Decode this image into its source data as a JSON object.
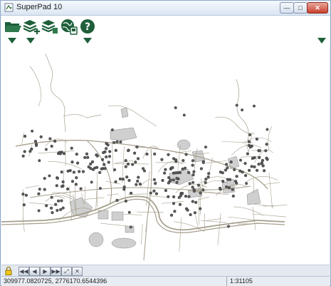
{
  "window": {
    "title": "SuperPad 10",
    "minimize": "—",
    "maximize": "□",
    "close": "✕"
  },
  "toolbar": {
    "tools": [
      {
        "icon": "open-folder-icon"
      },
      {
        "icon": "add-layer-icon"
      },
      {
        "icon": "layer-settings-icon"
      },
      {
        "icon": "gps-globe-icon"
      },
      {
        "icon": "help-icon",
        "label": "?"
      }
    ]
  },
  "nav": {
    "buttons": [
      "◀◀",
      "◀",
      "▶",
      "▶▶",
      "⤢",
      "✕"
    ]
  },
  "status": {
    "coords": "309977.0820725, 2776170.6544396",
    "scale": "1:31105"
  },
  "colors": {
    "road": "#a69f8c",
    "point": "#5a5a5a",
    "polygon": "#cfcfcf",
    "icon_green": "#1e5f3a"
  }
}
